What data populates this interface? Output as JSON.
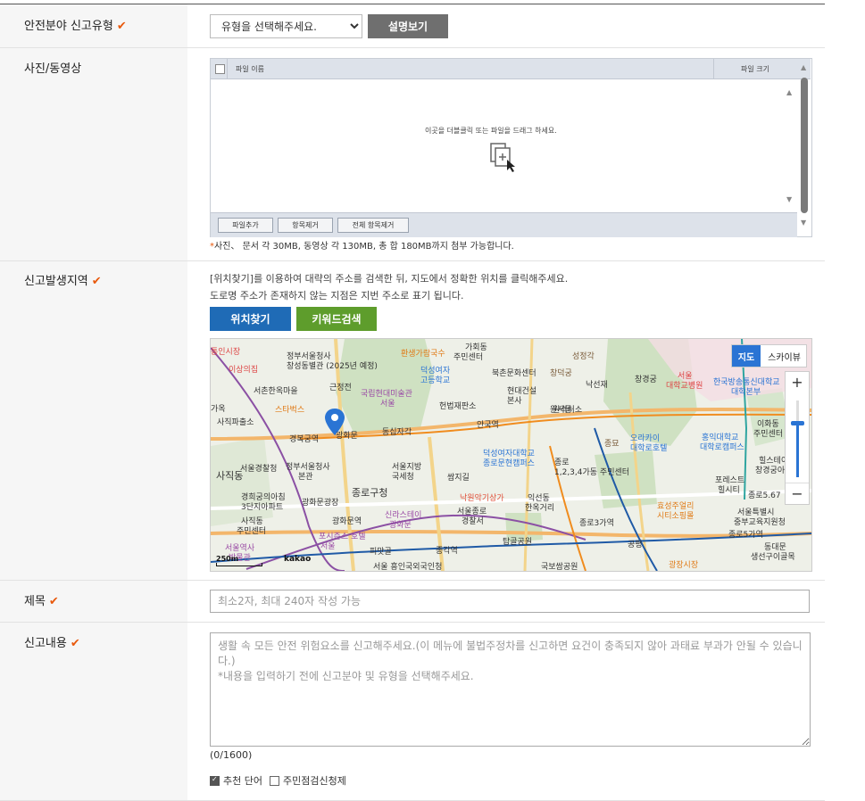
{
  "form": {
    "category": {
      "label": "안전분야 신고유형",
      "required_mark": "✔",
      "select_value": "유형을 선택해주세요.",
      "explain_button": "설명보기"
    },
    "media": {
      "label": "사진/동영상",
      "col_filename": "파일 이름",
      "col_filesize": "파일 크기",
      "drop_message": "이곳을 더블클릭 또는 파일을 드래그 하세요.",
      "add_file_button": "파일추가",
      "remove_item_button": "항목제거",
      "remove_all_button": "전체 항목제거",
      "note_star": "*",
      "note": "사진、 문서 각 30MB, 동영상 각 130MB, 총 합 180MB까지 첨부 가능합니다."
    },
    "location": {
      "label": "신고발생지역",
      "required_mark": "✔",
      "desc_line1": "[위치찾기]를 이용하여 대략의 주소를 검색한 뒤, 지도에서 정확한 위치를 클릭해주세요.",
      "desc_line2": "도로명 주소가 존재하지 않는 지점은 지번 주소로 표기 됩니다.",
      "find_button": "위치찾기",
      "keyword_button": "키워드검색",
      "map": {
        "type_map": "지도",
        "type_skyview": "스카이뷰",
        "zoom_in": "+",
        "zoom_out": "−",
        "scale_label": "250m",
        "provider_logo": "kakao",
        "accent_color": "#2a74d4",
        "places": [
          "통인시장",
          "정부서울청사",
          "창성동별관 (2025년 예정)",
          "가회동",
          "주민센터",
          "환생가람국수",
          "덕성여자",
          "고등학교",
          "북촌문화센터",
          "창덕궁",
          "성정각",
          "이상의집",
          "서촌한옥마을",
          "근정전",
          "국립현대미술관",
          "서울",
          "헌법재판소",
          "현대건설",
          "본사",
          "낙선재",
          "창경궁",
          "서울",
          "대학교병원",
          "한국방송통신대학교",
          "대학본부",
          "가옥",
          "스타벅스",
          "원서동",
          "원격처소",
          "사직파출소",
          "광화문",
          "동십자각",
          "안국역",
          "이화동",
          "주민센터",
          "경복궁역",
          "종묘",
          "오라카이",
          "대학로호텔",
          "홍익대학교",
          "대학로캠퍼스",
          "힐스테이",
          "창경궁아",
          "사직동",
          "서울경찰청",
          "정부서울청사",
          "본관",
          "서울지방",
          "국세청",
          "쌈지길",
          "덕성여자대학교",
          "종로문현캠퍼스",
          "종로",
          "1,2,3,4가동 주민센터",
          "종로구청",
          "낙원악기상가",
          "익선동",
          "한옥거리",
          "포레스트",
          "힐시티",
          "종로5.67",
          "경희궁의아침",
          "3단지아파트",
          "광화문광장",
          "신라스테이",
          "광화문",
          "서울종로",
          "경찰서",
          "종로3가역",
          "효성주얼리",
          "시티소핑몰",
          "서울특별시",
          "중부교육지원청",
          "사직동",
          "주민센터",
          "광화문역",
          "포시즌스 호텔",
          "서울",
          "탑골공원",
          "종로5가역",
          "동대문",
          "생선구이골목",
          "서울역사",
          "박물관",
          "피맛골",
          "종각역",
          "서울 흥인국외국인청",
          "국보쌈공원",
          "광장시장",
          "공평"
        ]
      }
    },
    "title": {
      "label": "제목",
      "required_mark": "✔",
      "placeholder": "최소2자, 최대 240자 작성 가능"
    },
    "content": {
      "label": "신고내용",
      "required_mark": "✔",
      "placeholder": "생활 속 모든 안전 위험요소를 신고해주세요.(이 메뉴에 불법주정차를 신고하면 요건이 충족되지 않아 과태료 부과가 안될 수 있습니다.)\n*내용을 입력하기 전에 신고분야 및 유형을 선택해주세요.",
      "counter": "(0/1600)",
      "option_recommend": "추천 단어",
      "option_resident": "주민점검신청제"
    }
  }
}
